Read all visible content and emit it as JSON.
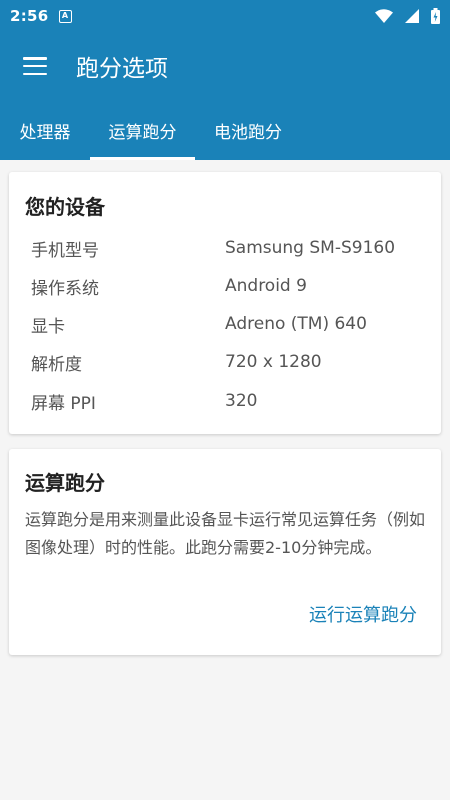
{
  "status_bar": {
    "time": "2:56",
    "notification_glyph": "A",
    "icons": [
      "wifi-icon",
      "signal-icon",
      "battery-icon"
    ]
  },
  "app_bar": {
    "title": "跑分选项",
    "menu_icon": "menu-icon"
  },
  "tabs": [
    {
      "label": "处理器",
      "active": false
    },
    {
      "label": "运算跑分",
      "active": true
    },
    {
      "label": "电池跑分",
      "active": false
    }
  ],
  "device_card": {
    "title": "您的设备",
    "rows": [
      {
        "label": "手机型号",
        "value": "Samsung SM-S9160"
      },
      {
        "label": "操作系统",
        "value": "Android 9"
      },
      {
        "label": "显卡",
        "value": "Adreno (TM) 640"
      },
      {
        "label": "解析度",
        "value": "720 x 1280"
      },
      {
        "label": "屏幕 PPI",
        "value": "320"
      }
    ]
  },
  "bench_card": {
    "title": "运算跑分",
    "description": "运算跑分是用来测量此设备显卡运行常见运算任务（例如图像处理）时的性能。此跑分需要2-10分钟完成。",
    "run_label": "运行运算跑分"
  },
  "colors": {
    "primary": "#1a82b8",
    "background": "#f5f5f5",
    "card": "#ffffff"
  }
}
